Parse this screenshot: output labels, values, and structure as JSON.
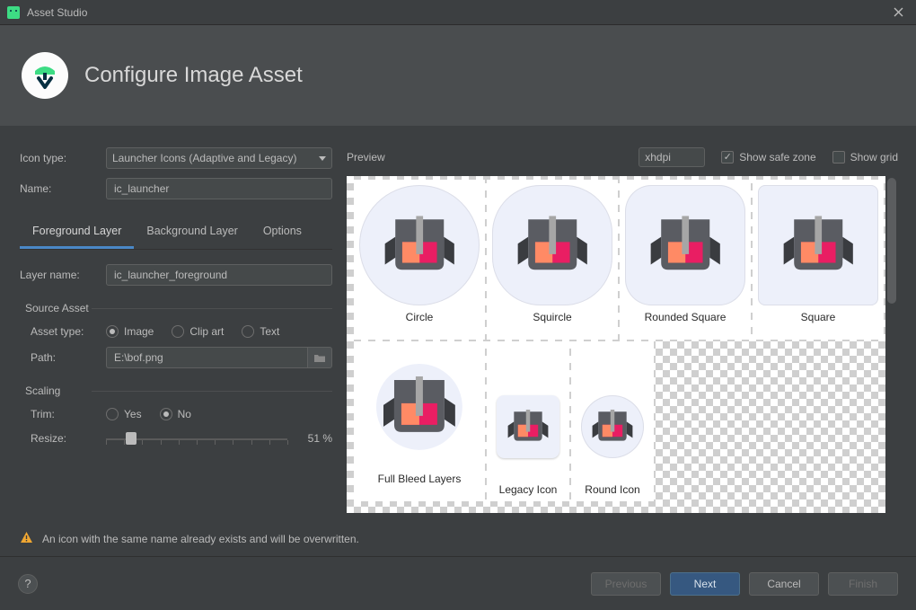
{
  "window": {
    "title": "Asset Studio"
  },
  "header": {
    "title": "Configure Image Asset"
  },
  "form": {
    "icon_type_label": "Icon type:",
    "icon_type_value": "Launcher Icons (Adaptive and Legacy)",
    "name_label": "Name:",
    "name_value": "ic_launcher",
    "tabs": {
      "foreground": "Foreground Layer",
      "background": "Background Layer",
      "options": "Options"
    },
    "layer_name_label": "Layer name:",
    "layer_name_value": "ic_launcher_foreground",
    "source_asset_label": "Source Asset",
    "asset_type_label": "Asset type:",
    "asset_type_options": {
      "image": "Image",
      "clipart": "Clip art",
      "text": "Text"
    },
    "asset_type_selected": "image",
    "path_label": "Path:",
    "path_value": "E:\\bof.png",
    "scaling_label": "Scaling",
    "trim_label": "Trim:",
    "trim_options": {
      "yes": "Yes",
      "no": "No"
    },
    "trim_selected": "no",
    "resize_label": "Resize:",
    "resize_value": "51 %",
    "resize_percent": 51
  },
  "preview": {
    "label": "Preview",
    "density_value": "xhdpi",
    "safe_zone_label": "Show safe zone",
    "safe_zone_checked": true,
    "grid_label": "Show grid",
    "grid_checked": false,
    "cells": {
      "circle": "Circle",
      "squircle": "Squircle",
      "rounded_square": "Rounded Square",
      "square": "Square",
      "full_bleed": "Full Bleed Layers",
      "legacy": "Legacy Icon",
      "round": "Round Icon"
    }
  },
  "warning": {
    "text": "An icon with the same name already exists and will be overwritten."
  },
  "buttons": {
    "previous": "Previous",
    "next": "Next",
    "cancel": "Cancel",
    "finish": "Finish",
    "help": "?"
  }
}
